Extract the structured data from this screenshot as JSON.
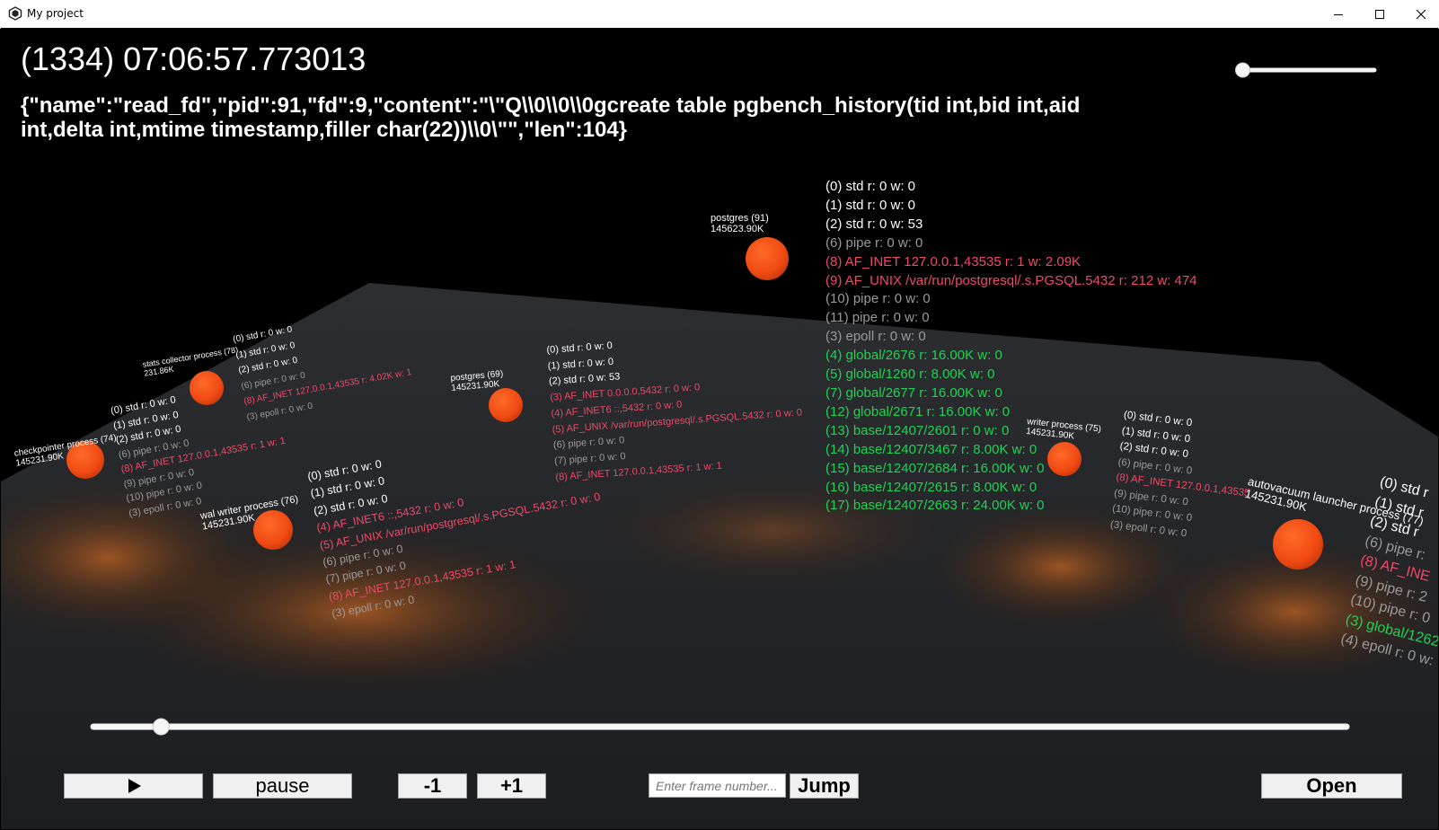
{
  "window": {
    "title": "My project"
  },
  "viewer": {
    "frame_title": "(1334) 07:06:57.773013",
    "event_json": "{\"name\":\"read_fd\",\"pid\":91,\"fd\":9,\"content\":\"\\\"Q\\\\0\\\\0\\\\0gcreate table pgbench_history(tid int,bid int,aid    int,delta int,mtime timestamp,filler char(22))\\\\0\\\"\",\"len\":104}"
  },
  "processes": [
    {
      "name": "postgres (91)",
      "mem": "145623.90K",
      "fds": [
        {
          "t": "(0) std r: 0 w: 0",
          "c": "white"
        },
        {
          "t": "(1) std r: 0 w: 0",
          "c": "white"
        },
        {
          "t": "(2) std r: 0 w: 53",
          "c": "white"
        },
        {
          "t": "(6) pipe r: 0 w: 0",
          "c": "gray"
        },
        {
          "t": "(8) AF_INET 127.0.0.1,43535 r: 1 w: 2.09K",
          "c": "red"
        },
        {
          "t": "(9) AF_UNIX /var/run/postgresql/.s.PGSQL.5432 r: 212 w: 474",
          "c": "red"
        },
        {
          "t": "(10) pipe r: 0 w: 0",
          "c": "gray"
        },
        {
          "t": "(11) pipe r: 0 w: 0",
          "c": "gray"
        },
        {
          "t": "(3) epoll r: 0 w: 0",
          "c": "gray"
        },
        {
          "t": "(4) global/2676 r: 16.00K w: 0",
          "c": "green"
        },
        {
          "t": "(5) global/1260 r: 8.00K w: 0",
          "c": "green"
        },
        {
          "t": "(7) global/2677 r: 16.00K w: 0",
          "c": "green"
        },
        {
          "t": "(12) global/2671 r: 16.00K w: 0",
          "c": "green"
        },
        {
          "t": "(13) base/12407/2601 r: 0 w: 0",
          "c": "green"
        },
        {
          "t": "(14) base/12407/3467 r: 8.00K w: 0",
          "c": "green"
        },
        {
          "t": "(15) base/12407/2684 r: 16.00K w: 0",
          "c": "green"
        },
        {
          "t": "(16) base/12407/2615 r: 8.00K w: 0",
          "c": "green"
        },
        {
          "t": "(17) base/12407/2663 r: 24.00K w: 0",
          "c": "green"
        }
      ]
    },
    {
      "name": "stats collector process (78)",
      "mem": "231.86K",
      "fds": [
        {
          "t": "(0) std r: 0 w: 0",
          "c": "white"
        },
        {
          "t": "(1) std r: 0 w: 0",
          "c": "white"
        },
        {
          "t": "(2) std r: 0 w: 0",
          "c": "white"
        },
        {
          "t": "(6) pipe r: 0 w: 0",
          "c": "gray"
        },
        {
          "t": "(8) AF_INET 127.0.0.1,43535 r: 4.02K w: 1",
          "c": "red"
        },
        {
          "t": "(3) epoll r: 0 w: 0",
          "c": "gray"
        }
      ]
    },
    {
      "name": "postgres (69)",
      "mem": "145231.90K",
      "fds": [
        {
          "t": "(0) std r: 0 w: 0",
          "c": "white"
        },
        {
          "t": "(1) std r: 0 w: 0",
          "c": "white"
        },
        {
          "t": "(2) std r: 0 w: 53",
          "c": "white"
        },
        {
          "t": "(3) AF_INET 0.0.0.0,5432 r: 0 w: 0",
          "c": "red"
        },
        {
          "t": "(4) AF_INET6 ::,5432 r: 0 w: 0",
          "c": "red"
        },
        {
          "t": "(5) AF_UNIX /var/run/postgresql/.s.PGSQL.5432 r: 0 w: 0",
          "c": "red"
        },
        {
          "t": "(6) pipe r: 0 w: 0",
          "c": "gray"
        },
        {
          "t": "(7) pipe r: 0 w: 0",
          "c": "gray"
        },
        {
          "t": "(8) AF_INET 127.0.0.1,43535 r: 1 w: 1",
          "c": "red"
        }
      ]
    },
    {
      "name": "checkpointer process (74)",
      "mem": "145231.90K",
      "fds": [
        {
          "t": "(0) std r: 0 w: 0",
          "c": "white"
        },
        {
          "t": "(1) std r: 0 w: 0",
          "c": "white"
        },
        {
          "t": "(2) std r: 0 w: 0",
          "c": "white"
        },
        {
          "t": "(6) pipe r: 0 w: 0",
          "c": "gray"
        },
        {
          "t": "(8) AF_INET 127.0.0.1,43535 r: 1 w: 1",
          "c": "red"
        },
        {
          "t": "(9) pipe r: 0 w: 0",
          "c": "gray"
        },
        {
          "t": "(10) pipe r: 0 w: 0",
          "c": "gray"
        },
        {
          "t": "(3) epoll r: 0 w: 0",
          "c": "gray"
        }
      ]
    },
    {
      "name": "wal writer process (76)",
      "mem": "145231.90K",
      "fds": [
        {
          "t": "(0) std r: 0 w: 0",
          "c": "white"
        },
        {
          "t": "(1) std r: 0 w: 0",
          "c": "white"
        },
        {
          "t": "(2) std r: 0 w: 0",
          "c": "white"
        },
        {
          "t": "(4) AF_INET6 ::,5432 r: 0 w: 0",
          "c": "red"
        },
        {
          "t": "(5) AF_UNIX /var/run/postgresql/.s.PGSQL.5432 r: 0 w: 0",
          "c": "red"
        },
        {
          "t": "(6) pipe r: 0 w: 0",
          "c": "gray"
        },
        {
          "t": "(7) pipe r: 0 w: 0",
          "c": "gray"
        },
        {
          "t": "(8) AF_INET 127.0.0.1,43535 r: 1 w: 1",
          "c": "red"
        },
        {
          "t": "(3) epoll r: 0 w: 0",
          "c": "gray"
        }
      ]
    },
    {
      "name": "writer process (75)",
      "mem": "145231.90K",
      "fds": [
        {
          "t": "(0) std r: 0 w: 0",
          "c": "white"
        },
        {
          "t": "(1) std r: 0 w: 0",
          "c": "white"
        },
        {
          "t": "(2) std r: 0 w: 0",
          "c": "white"
        },
        {
          "t": "(6) pipe r: 0 w: 0",
          "c": "gray"
        },
        {
          "t": "(8) AF_INET 127.0.0.1,43535",
          "c": "red"
        },
        {
          "t": "(9) pipe r: 0 w: 0",
          "c": "gray"
        },
        {
          "t": "(10) pipe r: 0 w: 0",
          "c": "gray"
        },
        {
          "t": "(3) epoll r: 0 w: 0",
          "c": "gray"
        }
      ]
    },
    {
      "name": "autovacuum launcher process (77)",
      "mem": "145231.90K",
      "fds": [
        {
          "t": "(0) std r",
          "c": "white"
        },
        {
          "t": "(1) std r",
          "c": "white"
        },
        {
          "t": "(2) std r",
          "c": "white"
        },
        {
          "t": "(6) pipe r:",
          "c": "gray"
        },
        {
          "t": "(8) AF_INE",
          "c": "red"
        },
        {
          "t": "(9) pipe r: 2",
          "c": "gray"
        },
        {
          "t": "(10) pipe r: 0",
          "c": "gray"
        },
        {
          "t": "(3) global/1262",
          "c": "green"
        },
        {
          "t": "(4) epoll r: 0 w:",
          "c": "gray"
        }
      ]
    }
  ],
  "controls": {
    "play_icon": "play-icon",
    "pause_label": "pause",
    "minus_label": "-1",
    "plus_label": "+1",
    "frame_placeholder": "Enter frame number...",
    "jump_label": "Jump",
    "open_label": "Open",
    "timeline_progress": 0.054,
    "zoom_level": 0.05
  }
}
